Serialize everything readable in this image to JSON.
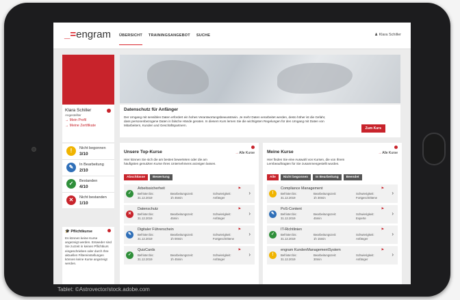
{
  "credit": "Tablet: ©Astrovector/stock.adobe.com",
  "header": {
    "logo": "engram",
    "nav": [
      "ÜBERSICHT",
      "TRAININGSANGEBOT",
      "SUCHE"
    ],
    "user": "Klara Schiller"
  },
  "profile": {
    "name": "Klara Schiller",
    "role": "Angestellter",
    "links": [
      "Mein Profil",
      "Meine Zertifikate"
    ]
  },
  "stats": [
    {
      "label": "Nicht begonnen",
      "value": "3/10",
      "color": "#f0b400",
      "glyph": "!"
    },
    {
      "label": "In Bearbeitung",
      "value": "2/10",
      "color": "#2f6fb8",
      "glyph": "✎"
    },
    {
      "label": "Bestanden",
      "value": "4/10",
      "color": "#2f8f3a",
      "glyph": "✓"
    },
    {
      "label": "Nicht bestanden",
      "value": "1/10",
      "color": "#c8232b",
      "glyph": "✕"
    }
  ],
  "pflicht": {
    "title": "Pflichtkurse",
    "text": "Es können keine Kurse angezeigt werden. Entweder sind Sie zurzeit in keinen Pflichtkurs eingeschrieben oder durch Ihre aktuellen Filtereinstellungen können keine Kurse angezeigt werden."
  },
  "hero": {
    "title": "Datenschutz für Anfänger",
    "text": "Der Umgang mit sensiblen Daten erfordert ein hohes Verantwortungsbewusstsein. Je mehr Daten verarbeitet werden, desto höher ist die Gefahr, dass personenbezogene Daten in falsche Hände geraten. In diesem Kurs lernen Sie die wichtigsten Regelungen für den Umgang mit Daten von Mitarbeitern, Kunden und Geschäftspartnern.",
    "button": "Zum Kurs"
  },
  "top": {
    "title": "Unsere Top-Kurse",
    "all": "Alle Kurse",
    "text": "Hier können Sie sich die am besten bewerteten oder die am häufigsten genutzten Kurse Ihres Unternehmens anzeigen lassen.",
    "filters": [
      "Abschlüsse",
      "Bewertung"
    ],
    "courses": [
      {
        "title": "Arbeitssicherheit",
        "status": "#2f8f3a",
        "glyph": "✓",
        "due_label": "Befristet bis:",
        "due": "31.12.2019",
        "time_label": "Bearbeitungszeit:",
        "time": "1h 45min",
        "level_label": "Schwierigkeit:",
        "level": "Anfänger"
      },
      {
        "title": "Datenschutz",
        "status": "#c8232b",
        "glyph": "✕",
        "due_label": "Befristet bis:",
        "due": "31.12.2019",
        "time_label": "Bearbeitungszeit:",
        "time": "45min",
        "level_label": "Schwierigkeit:",
        "level": "Anfänger"
      },
      {
        "title": "Digitaler Führerschein",
        "status": "#2f6fb8",
        "glyph": "✎",
        "due_label": "Befristet bis:",
        "due": "31.12.2019",
        "time_label": "Bearbeitungszeit:",
        "time": "1h 00min",
        "level_label": "Schwierigkeit:",
        "level": "Fortgeschrittene"
      },
      {
        "title": "QuizCards",
        "status": "#2f8f3a",
        "glyph": "✓",
        "due_label": "Befristet bis:",
        "due": "31.12.2019",
        "time_label": "Bearbeitungszeit:",
        "time": "1h 45min",
        "level_label": "Schwierigkeit:",
        "level": "Anfänger"
      }
    ]
  },
  "mine": {
    "title": "Meine Kurse",
    "all": "Alle Kurse",
    "text": "Hier finden Sie eine Auswahl von Kursen, die von Ihrem Lernbeauftragten für Sie zusammengestellt wurden.",
    "filters": [
      "Alle",
      "Nicht begonnen",
      "In Bearbeitung",
      "Beendet"
    ],
    "courses": [
      {
        "title": "Compliance Management",
        "status": "#f0b400",
        "glyph": "!",
        "due_label": "Befristet bis:",
        "due": "31.12.2019",
        "time_label": "Bearbeitungszeit:",
        "time": "1h 30min",
        "level_label": "Schwierigkeit:",
        "level": "Fortgeschrittene"
      },
      {
        "title": "PoS-Content",
        "status": "#2f6fb8",
        "glyph": "✎",
        "due_label": "Befristet bis:",
        "due": "31.12.2019",
        "time_label": "Bearbeitungszeit:",
        "time": "45min",
        "level_label": "Schwierigkeit:",
        "level": "Experte"
      },
      {
        "title": "IT-Richtlinien",
        "status": "#2f8f3a",
        "glyph": "✓",
        "due_label": "Befristet bis:",
        "due": "31.12.2019",
        "time_label": "Bearbeitungszeit:",
        "time": "1h 15min",
        "level_label": "Schwierigkeit:",
        "level": "Anfänger"
      },
      {
        "title": "engram KundenManagementSystem",
        "status": "#f0b400",
        "glyph": "!",
        "due_label": "Befristet bis:",
        "due": "31.12.2019",
        "time_label": "Bearbeitungszeit:",
        "time": "30min",
        "level_label": "Schwierigkeit:",
        "level": "Anfänger"
      }
    ]
  }
}
